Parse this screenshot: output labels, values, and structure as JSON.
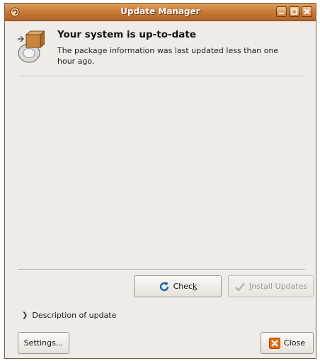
{
  "window": {
    "title": "Update Manager"
  },
  "header": {
    "title": "Your system is up-to-date",
    "description": "The package information was last updated less than one hour ago."
  },
  "buttons": {
    "check": {
      "label_pre": "Chec",
      "label_mnemonic": "k",
      "icon": "refresh-icon"
    },
    "install": {
      "label_pre": "",
      "label_mnemonic": "I",
      "label_post": "nstall Updates",
      "icon": "checkmark-icon",
      "enabled": false
    },
    "settings": {
      "label": "Settings..."
    },
    "close": {
      "label": "Close",
      "icon": "close-icon"
    }
  },
  "expander": {
    "label": "Description of update",
    "expanded": false
  },
  "colors": {
    "titlebar": "#c97b36",
    "window_bg": "#efebe7",
    "close_icon": "#e86a10"
  }
}
